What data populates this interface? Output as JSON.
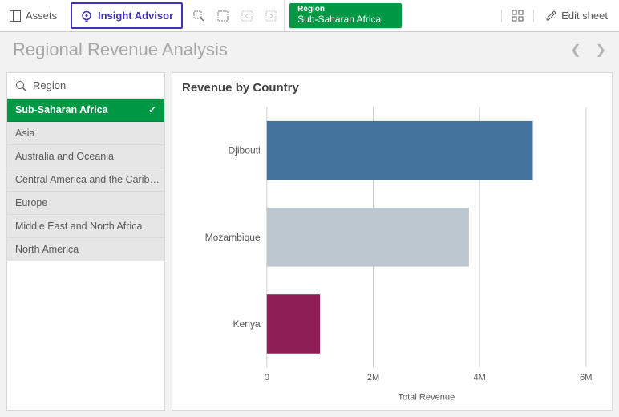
{
  "toolbar": {
    "assets_label": "Assets",
    "insight_label": "Insight Advisor",
    "selection_pill": {
      "field": "Region",
      "value": "Sub-Saharan Africa"
    },
    "edit_label": "Edit sheet"
  },
  "sheet": {
    "title": "Regional Revenue Analysis"
  },
  "filter": {
    "search_label": "Region",
    "items": [
      {
        "label": "Sub-Saharan Africa",
        "selected": true
      },
      {
        "label": "Asia",
        "selected": false
      },
      {
        "label": "Australia and Oceania",
        "selected": false
      },
      {
        "label": "Central America and the Carib…",
        "selected": false
      },
      {
        "label": "Europe",
        "selected": false
      },
      {
        "label": "Middle East and North Africa",
        "selected": false
      },
      {
        "label": "North America",
        "selected": false
      }
    ]
  },
  "chart": {
    "title": "Revenue by Country",
    "xlabel": "Total Revenue"
  },
  "chart_data": {
    "type": "bar",
    "orientation": "horizontal",
    "categories": [
      "Djibouti",
      "Mozambique",
      "Kenya"
    ],
    "values": [
      5000000,
      3800000,
      1000000
    ],
    "colors": [
      "#44749d",
      "#bcc7cf",
      "#8e1f56"
    ],
    "xlabel": "Total Revenue",
    "xlim": [
      0,
      6000000
    ],
    "xticks": [
      0,
      2000000,
      4000000,
      6000000
    ],
    "xtick_labels": [
      "0",
      "2M",
      "4M",
      "6M"
    ]
  }
}
